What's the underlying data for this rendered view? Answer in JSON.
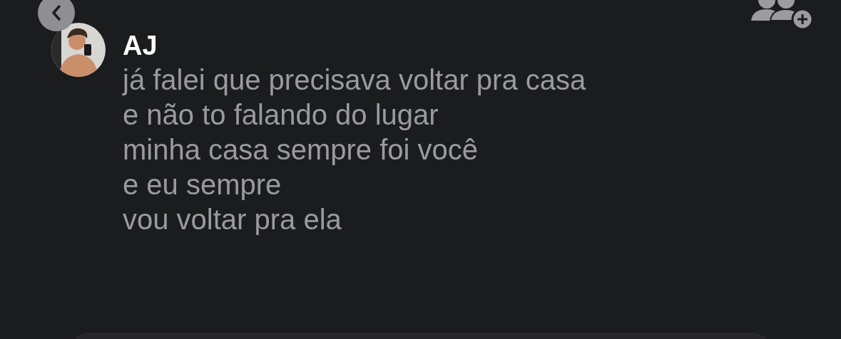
{
  "message": {
    "sender": "AJ",
    "lines": [
      "já falei que precisava voltar pra casa",
      "e não to falando do lugar",
      "minha casa sempre foi você",
      "e eu sempre",
      "vou voltar pra ela"
    ]
  }
}
